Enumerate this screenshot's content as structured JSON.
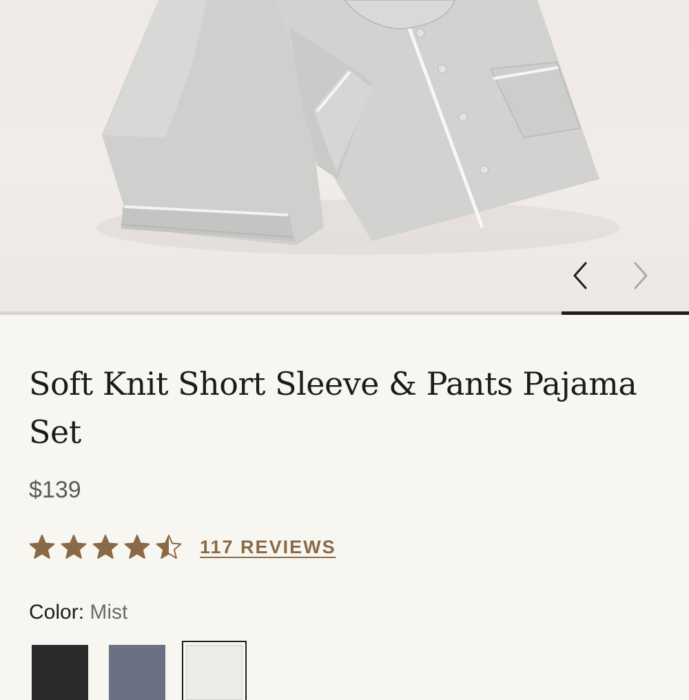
{
  "gallery": {
    "prev_icon": "chevron-left-icon",
    "next_icon": "chevron-right-icon",
    "progress": {
      "start": 0.815,
      "end": 1.0
    }
  },
  "product": {
    "title": "Soft Knit Short Sleeve & Pants Pajama Set",
    "price": "$139",
    "rating": 4.5,
    "rating_max": 5,
    "reviews_label": "117 REVIEWS",
    "star_color": "#8a6a46"
  },
  "color": {
    "label": "Color:",
    "selected": "Mist",
    "swatches": [
      {
        "name": "black",
        "hex": "#2a2a2a",
        "selected": false
      },
      {
        "name": "slate",
        "hex": "#6b7185",
        "selected": false
      },
      {
        "name": "mist",
        "hex": "#ecebe8",
        "selected": true
      }
    ]
  }
}
